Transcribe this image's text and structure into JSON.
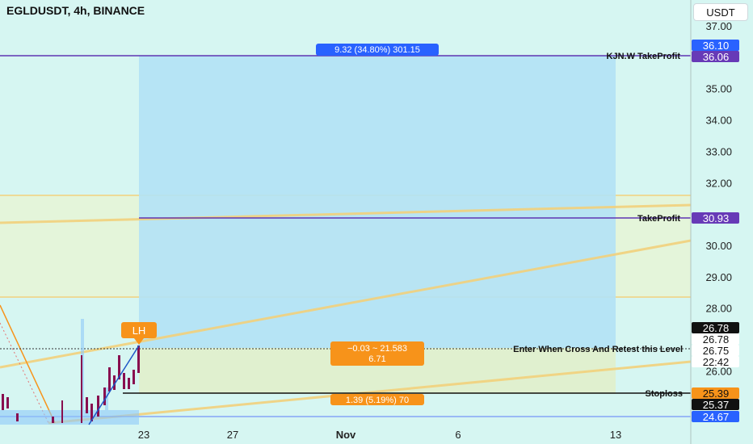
{
  "symbol_title": "EGLDUSDT, 4h, BINANCE",
  "currency_button": "USDT",
  "chart_data": {
    "type": "line",
    "title": "EGLDUSDT, 4h, BINANCE",
    "y_axis": {
      "unit": "USDT",
      "ticks": [
        "37.00",
        "35.00",
        "34.00",
        "33.00",
        "32.00",
        "30.00",
        "29.00",
        "28.00",
        "26.00"
      ],
      "ylim": [
        24.3,
        37.5
      ]
    },
    "x_axis": {
      "ticks": [
        "23",
        "27",
        "Nov",
        "6",
        "13"
      ]
    },
    "price_tags": [
      {
        "value": "36.10",
        "color": "#2962ff",
        "text_color": "#ffffff"
      },
      {
        "value": "36.06",
        "color": "#673ab7",
        "text_color": "#ffffff"
      },
      {
        "value": "30.93",
        "color": "#673ab7",
        "text_color": "#ffffff"
      },
      {
        "value": "26.78",
        "color": "#111111",
        "text_color": "#ffffff"
      },
      {
        "value": "26.78",
        "color": "#ffffff",
        "text_color": "#111111"
      },
      {
        "value": "26.75",
        "color": "#ffffff",
        "text_color": "#111111"
      },
      {
        "value": "22:42",
        "color": "#ffffff",
        "text_color": "#111111"
      },
      {
        "value": "25.39",
        "color": "#f7931a",
        "text_color": "#111111"
      },
      {
        "value": "25.37",
        "color": "#111111",
        "text_color": "#ffffff"
      },
      {
        "value": "24.67",
        "color": "#2962ff",
        "text_color": "#ffffff"
      }
    ],
    "levels": [
      {
        "label": "KJN.W TakeProfit",
        "price": 36.06
      },
      {
        "label": "TakeProfit",
        "price": 30.93
      },
      {
        "label": "Enter When Cross And Retest this Level",
        "price": 26.75
      },
      {
        "label": "Stoploss",
        "price": 25.39
      }
    ],
    "position_labels": {
      "target": "9.32 (34.80%) 301.15",
      "entry_line1": "−0.03 ~ 21.583",
      "entry_line2": "6.71",
      "stop": "1.39 (5.19%) 70"
    },
    "annotation": "LH",
    "colors": {
      "background": "#d6f6f2",
      "profit_zone": "#b3e5fc",
      "loss_zone": "#dcedc8",
      "level_line": "#5e35b1",
      "trend_line": "#f2d17c",
      "accent_orange": "#f7931a"
    }
  }
}
